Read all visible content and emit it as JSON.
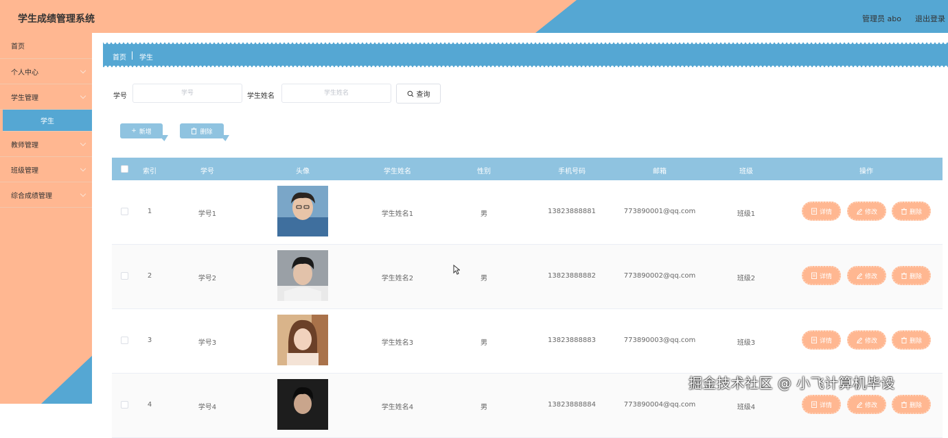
{
  "header": {
    "title": "学生成绩管理系统",
    "admin": "管理员 abo",
    "logout": "退出登录"
  },
  "sidebar": {
    "items": [
      {
        "label": "首页",
        "expandable": false
      },
      {
        "label": "个人中心",
        "expandable": true
      },
      {
        "label": "学生管理",
        "expandable": true
      },
      {
        "label": "学生",
        "active": true
      },
      {
        "label": "教师管理",
        "expandable": true
      },
      {
        "label": "班级管理",
        "expandable": true
      },
      {
        "label": "综合成绩管理",
        "expandable": true
      }
    ]
  },
  "breadcrumb": {
    "home": "首页",
    "current": "学生"
  },
  "search": {
    "student_no_label": "学号",
    "student_no_placeholder": "学号",
    "student_name_label": "学生姓名",
    "student_name_placeholder": "学生姓名",
    "query_label": "查询"
  },
  "toolbar": {
    "add_label": "新增",
    "delete_label": "删除"
  },
  "table": {
    "columns": [
      "索引",
      "学号",
      "头像",
      "学生姓名",
      "性别",
      "手机号码",
      "邮箱",
      "班级",
      "操作"
    ],
    "actions": {
      "detail": "详情",
      "edit": "修改",
      "delete": "删除"
    },
    "rows": [
      {
        "index": "1",
        "student_no": "学号1",
        "name": "学生姓名1",
        "gender": "男",
        "phone": "13823888881",
        "email": "773890001@qq.com",
        "class": "班级1"
      },
      {
        "index": "2",
        "student_no": "学号2",
        "name": "学生姓名2",
        "gender": "男",
        "phone": "13823888882",
        "email": "773890002@qq.com",
        "class": "班级2"
      },
      {
        "index": "3",
        "student_no": "学号3",
        "name": "学生姓名3",
        "gender": "男",
        "phone": "13823888883",
        "email": "773890003@qq.com",
        "class": "班级3"
      },
      {
        "index": "4",
        "student_no": "学号4",
        "name": "学生姓名4",
        "gender": "男",
        "phone": "13823888884",
        "email": "773890004@qq.com",
        "class": "班级4"
      }
    ]
  },
  "watermark": "掘金技术社区 @ 小飞计算机毕设",
  "colors": {
    "peach": "#ffb791",
    "blue": "#55a7d3",
    "table_header": "#8fc3e0"
  }
}
